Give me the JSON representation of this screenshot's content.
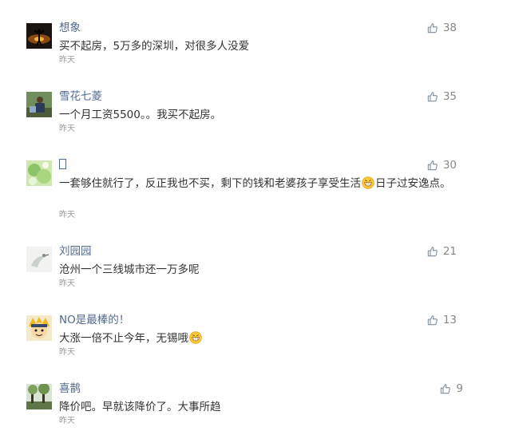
{
  "comments": [
    {
      "name": "想象",
      "text": "买不起房，5万多的深圳，对很多人没爱",
      "time": "昨天",
      "likes": "38",
      "avatar": "silhouette-avatar"
    },
    {
      "name": "雪花七菱",
      "text": "一个月工资5500。。我买不起房。",
      "time": "昨天",
      "likes": "35",
      "avatar": "person-outdoor-avatar"
    },
    {
      "name": "",
      "text_before_emoji": "一套够住就行了，反正我也不买，剩下的钱和老婆孩子享受生活",
      "text_after_emoji": "日子过安逸点。",
      "time": "昨天",
      "likes": "30",
      "avatar": "green-leaf-avatar"
    },
    {
      "name": "刘园园",
      "text": "沧州一个三线城市还一万多呢",
      "time": "昨天",
      "likes": "21",
      "avatar": "bird-avatar"
    },
    {
      "name": "NO是最棒的！",
      "text_before_emoji": "大涨一倍不止今年，无锡哦",
      "text_after_emoji": "",
      "time": "昨天",
      "likes": "13",
      "avatar": "cartoon-avatar"
    },
    {
      "name": "喜鹊",
      "text": "降价吧。早就该降价了。大事所趋",
      "time": "昨天",
      "likes": "9",
      "avatar": "trees-avatar"
    }
  ],
  "colors": {
    "name": "#526a8f",
    "text": "#333333",
    "time": "#999999",
    "like": "#888888"
  },
  "icons": {
    "like": "thumbs-up-icon",
    "emoji": "grin-emoji-icon"
  }
}
